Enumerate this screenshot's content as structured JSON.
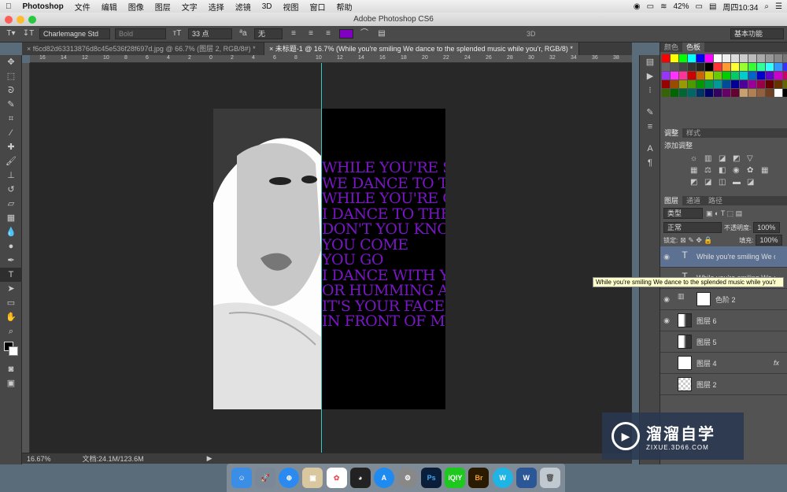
{
  "menubar": {
    "app": "Photoshop",
    "items": [
      "文件",
      "编辑",
      "图像",
      "图层",
      "文字",
      "选择",
      "滤镜",
      "3D",
      "视图",
      "窗口",
      "帮助"
    ],
    "battery": "42%",
    "clock": "周四10:34"
  },
  "window_title": "Adobe Photoshop CS6",
  "options": {
    "font_family": "Charlemagne Std",
    "font_style": "Bold",
    "font_size": "33 点",
    "antialias_label": "ªa",
    "antialias": "无",
    "text_color": "#8000c0",
    "mode3d": "3D",
    "workspace": "基本功能"
  },
  "tabs": [
    {
      "label": "f6cd82d63313876d8c45e536f28f697d.jpg @ 66.7% (图层 2, RGB/8#) *",
      "close": "×"
    },
    {
      "label": "未标题-1 @ 16.7% (While you're smiling We dance to the splended music while you'r, RGB/8) *",
      "close": "×"
    }
  ],
  "ruler_ticks": [
    "16",
    "14",
    "12",
    "10",
    "8",
    "6",
    "4",
    "2",
    "0",
    "2",
    "4",
    "6",
    "8",
    "10",
    "12",
    "14",
    "16",
    "18",
    "20",
    "22",
    "24",
    "26",
    "28",
    "30",
    "32",
    "34",
    "36",
    "38"
  ],
  "poem_lines": [
    "WHILE YOU'RE SM",
    "WE DANCE TO TH",
    "WHILE YOU'RE CR",
    "I DANCE TO THE C",
    "DON'T YOU KNOW",
    "YOU COME",
    "YOU GO",
    "I DANCE WITH YO",
    "OR HUMMING AL",
    "IT'S YOUR FACE",
    "IN FRONT OF MY"
  ],
  "status": {
    "zoom": "16.67%",
    "doc_size": "文档:24.1M/123.6M"
  },
  "panels": {
    "color_tabs": [
      "颜色",
      "色板"
    ],
    "swatch_colors": [
      "#ff0000",
      "#ffff00",
      "#00ff00",
      "#00ffff",
      "#0000ff",
      "#ff00ff",
      "#ffffff",
      "#eeeeee",
      "#dddddd",
      "#cccccc",
      "#bbbbbb",
      "#aaaaaa",
      "#999999",
      "#888888",
      "#777777",
      "#666666",
      "#555555",
      "#444444",
      "#333333",
      "#222222",
      "#000000",
      "#ff3333",
      "#ff9933",
      "#ffff33",
      "#99ff33",
      "#33ff33",
      "#33ff99",
      "#33ffff",
      "#3399ff",
      "#3333ff",
      "#9933ff",
      "#ff33ff",
      "#ff3399",
      "#cc0000",
      "#cc6600",
      "#cccc00",
      "#66cc00",
      "#00cc00",
      "#00cc66",
      "#00cccc",
      "#0066cc",
      "#0000cc",
      "#6600cc",
      "#cc00cc",
      "#cc0066",
      "#990000",
      "#994c00",
      "#999900",
      "#4c9900",
      "#009900",
      "#00994c",
      "#009999",
      "#004c99",
      "#000099",
      "#4c0099",
      "#990099",
      "#99004c",
      "#660000",
      "#663300",
      "#666600",
      "#336600",
      "#006600",
      "#006633",
      "#006666",
      "#003366",
      "#000066",
      "#330066",
      "#660066",
      "#660033",
      "#c8a070",
      "#b08050",
      "#906040",
      "#704020",
      "#ffffff",
      "#000000"
    ],
    "adjust_tabs": [
      "调整",
      "样式"
    ],
    "adjust_title": "添加调整",
    "layer_tabs": [
      "图层",
      "通道",
      "路径"
    ],
    "filter_kind": "类型",
    "blend_mode": "正常",
    "opacity_label": "不透明度:",
    "opacity": "100%",
    "lock_label": "锁定:",
    "fill_label": "填充:",
    "fill": "100%",
    "layers": [
      {
        "name": "While you're smiling We d...",
        "visible": true,
        "selected": true,
        "thumb": "T"
      },
      {
        "name": "While you're smiling We d...",
        "visible": false,
        "selected": false,
        "thumb": "T"
      },
      {
        "name": "色阶 2",
        "visible": true,
        "selected": false,
        "thumb": "levels"
      },
      {
        "name": "图层 6",
        "visible": true,
        "selected": false,
        "thumb": "photo"
      },
      {
        "name": "图层 5",
        "visible": false,
        "selected": false,
        "thumb": "photo"
      },
      {
        "name": "图层 4",
        "visible": false,
        "selected": false,
        "thumb": "white",
        "fx": "fx"
      },
      {
        "name": "图层 2",
        "visible": false,
        "selected": false,
        "thumb": "checker"
      }
    ]
  },
  "tooltip": "While you're smiling We dance to the splended music while you'r",
  "watermark": {
    "title": "溜溜自学",
    "sub": "ZIXUE.3D66.COM"
  },
  "dock": [
    "Finder",
    "Launchpad",
    "Safari",
    "Preview",
    "Photos",
    "QQ",
    "App Store",
    "System Preferences",
    "Ps",
    "iQIYI",
    "Br",
    "W",
    "Word",
    "Trash"
  ],
  "dock_labels": {
    "ps": "Ps",
    "iqiyi": "iQIY",
    "br": "Br",
    "w": "W",
    "word": "W"
  }
}
